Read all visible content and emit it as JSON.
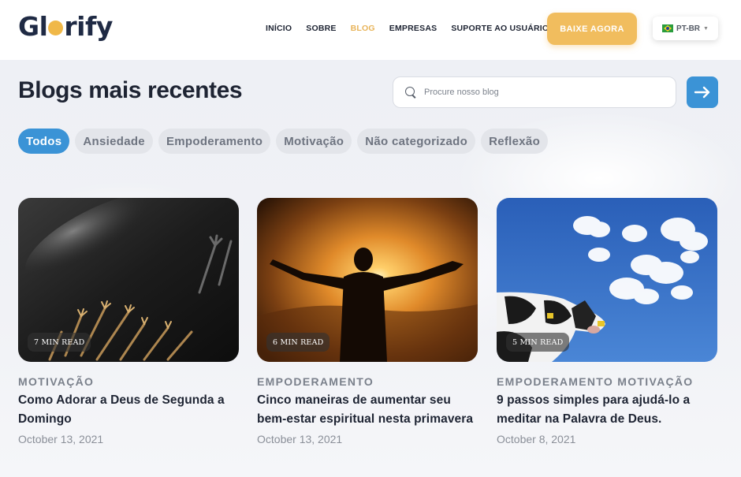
{
  "brand": {
    "name_start": "Gl",
    "name_end": "rify",
    "accent": "#f0b848"
  },
  "nav": {
    "items": [
      "INÍCIO",
      "SOBRE",
      "BLOG",
      "EMPRESAS",
      "SUPORTE AO USUÁRIO"
    ],
    "active": "BLOG",
    "cta": "BAIXE AGORA",
    "language": "PT-BR"
  },
  "page": {
    "title": "Blogs mais recentes"
  },
  "search": {
    "placeholder": "Procure nosso blog",
    "icon": "search-icon",
    "submit_icon": "arrow-right-icon"
  },
  "filters": {
    "items": [
      "Todos",
      "Ansiedade",
      "Empoderamento",
      "Motivação",
      "Não categorizado",
      "Reflexão"
    ],
    "active": "Todos"
  },
  "posts": [
    {
      "read_time": "7 MIN READ",
      "category": "MOTIVAÇÃO",
      "title": "Como Adorar a Deus de Segunda a Domingo",
      "date": "October 13, 2021",
      "image": "worship-hands-in-light"
    },
    {
      "read_time": "6 MIN READ",
      "category": "EMPODERAMENTO",
      "title": "Cinco maneiras de aumentar seu bem-estar espiritual nesta primavera",
      "date": "October 13, 2021",
      "image": "man-arms-open-sunset"
    },
    {
      "read_time": "5 MIN READ",
      "category": "EMPODERAMENTO MOTIVAÇÃO",
      "title": "9 passos simples para ajudá-lo a meditar na Palavra de Deus.",
      "date": "October 8, 2021",
      "image": "cow-under-blue-sky"
    }
  ],
  "colors": {
    "primary": "#3b93d6",
    "cta": "#f1bd5e",
    "active_nav": "#e8b45a",
    "text": "#1e2433"
  }
}
